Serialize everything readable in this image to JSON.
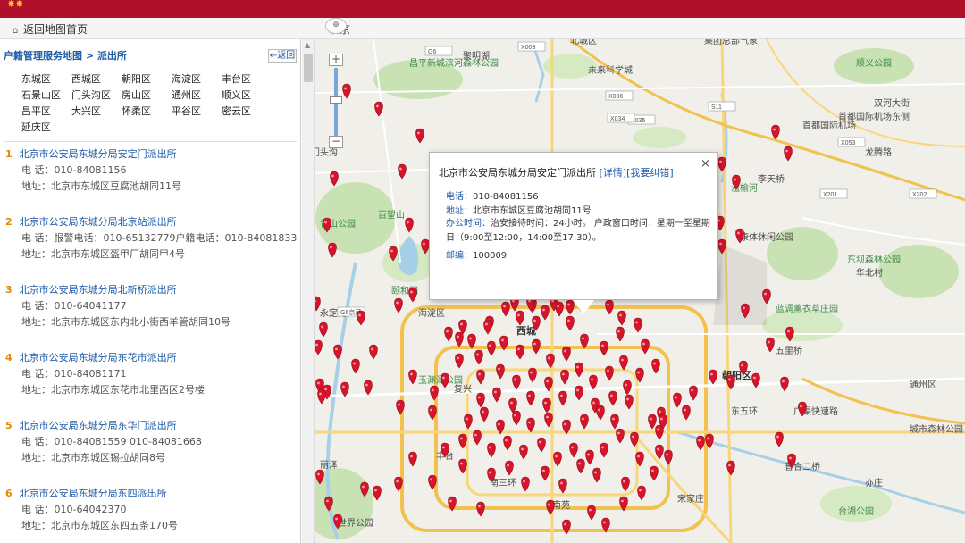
{
  "header": {
    "home_link": "返回地图首页",
    "city": "北京"
  },
  "sidebar": {
    "breadcrumb": "户籍管理服务地图 > 派出所",
    "back_button": "返回",
    "districts": [
      "东城区",
      "西城区",
      "朝阳区",
      "海淀区",
      "丰台区",
      "石景山区",
      "门头沟区",
      "房山区",
      "通州区",
      "顺义区",
      "昌平区",
      "大兴区",
      "怀柔区",
      "平谷区",
      "密云区",
      "延庆区"
    ],
    "stations": [
      {
        "num": "1",
        "name": "北京市公安局东城分局安定门派出所",
        "phone": "电 话：010-84081156",
        "address": "地址：北京市东城区豆腐池胡同11号"
      },
      {
        "num": "2",
        "name": "北京市公安局东城分局北京站派出所",
        "phone": "电 话：报警电话：010-65132779户籍电话：010-84081833",
        "address": "地址：北京市东城区盔甲厂胡同甲4号"
      },
      {
        "num": "3",
        "name": "北京市公安局东城分局北新桥派出所",
        "phone": "电 话：010-64041177",
        "address": "地址：北京市东城区东内北小街西羊管胡同10号"
      },
      {
        "num": "4",
        "name": "北京市公安局东城分局东花市派出所",
        "phone": "电 话：010-84081171",
        "address": "地址：北京市东城区东花市北里西区2号楼"
      },
      {
        "num": "5",
        "name": "北京市公安局东城分局东华门派出所",
        "phone": "电 话：010-84081559 010-84081668",
        "address": "地址：北京市东城区锡拉胡同8号"
      },
      {
        "num": "6",
        "name": "北京市公安局东城分局东四派出所",
        "phone": "电 话：010-64042370",
        "address": "地址：北京市东城区东四五条170号"
      }
    ]
  },
  "popup": {
    "title": "北京市公安局东城分局安定门派出所",
    "detail_link": "[详情]",
    "complaint_link": "[我要纠错]",
    "close": "×",
    "phone_key": "电话：",
    "phone_val": "010-84081156",
    "address_key": "地址：",
    "address_val": "北京市东城区豆腐池胡同11号",
    "hours_key": "办公时间：",
    "hours_val": "治安接待时间：24小时。 户政窗口时间：星期一至星期日（9:00至12:00，14:00至17:30）。",
    "zip_key": "邮编：",
    "zip_val": "100009"
  },
  "map": {
    "zoom_in": "+",
    "zoom_out": "−",
    "labels": [
      "昌平新城滨河森林公园",
      "聚明湖",
      "未来科学城",
      "集团总部气象",
      "北城区",
      "顺义公园",
      "双河大街",
      "首都国际机场",
      "龙腾路",
      "朝阳公园",
      "温榆河",
      "李天桥",
      "东坝森林公园",
      "华北村",
      "青山公园",
      "百望山",
      "颐和园",
      "海淀区",
      "玉渊潭公园",
      "复兴",
      "通州区",
      "丰台",
      "广渠快速路",
      "城市森林公园",
      "南三环",
      "西城",
      "朝阳区",
      "东五环",
      "普合二桥",
      "台湖公园",
      "丽泽",
      "亦庄",
      "世界公园",
      "永定河",
      "门头沟",
      "蓝调薰衣草庄园",
      "康体休闲公园",
      "首都国际机场东侧",
      "五里桥",
      "宋家庄",
      "南苑"
    ],
    "road_ids": [
      "X003",
      "G6",
      "X036",
      "X035",
      "X034",
      "X053",
      "X202",
      "X201",
      "G6京藏",
      "S11"
    ]
  },
  "colors": {
    "brand": "#b0102a",
    "link": "#1e5ba8",
    "pin": "#d8142a",
    "green": "#c8e2b4",
    "water": "#a8cfe8"
  }
}
